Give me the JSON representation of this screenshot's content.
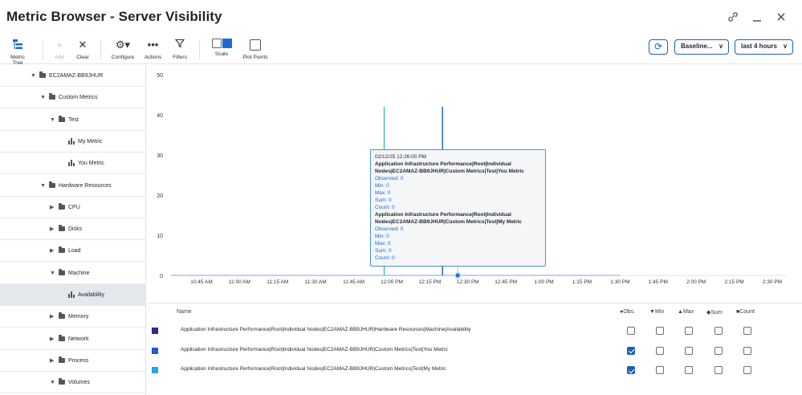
{
  "window": {
    "title": "Metric Browser - Server Visibility"
  },
  "toolbar": {
    "metric_tree": "Metric Tree",
    "add": "Add",
    "clear": "Clear",
    "configure": "Configure",
    "actions": "Actions",
    "filters": "Filters",
    "scale": "Scale",
    "plot_points": "Plot Points",
    "baseline": "Baseline...",
    "time_range": "last 4 hours"
  },
  "tree": [
    {
      "label": "EC2AMAZ-BB9JHUR",
      "type": "folder",
      "depth": 0,
      "expanded": true
    },
    {
      "label": "Custom Metrics",
      "type": "folder",
      "depth": 1,
      "expanded": true
    },
    {
      "label": "Test",
      "type": "folder",
      "depth": 2,
      "expanded": true
    },
    {
      "label": "My Metric",
      "type": "metric",
      "depth": 3
    },
    {
      "label": "You Metric",
      "type": "metric",
      "depth": 3
    },
    {
      "label": "Hardware Resources",
      "type": "folder",
      "depth": 1,
      "expanded": true
    },
    {
      "label": "CPU",
      "type": "folder",
      "depth": 2,
      "expanded": false
    },
    {
      "label": "Disks",
      "type": "folder",
      "depth": 2,
      "expanded": false
    },
    {
      "label": "Load",
      "type": "folder",
      "depth": 2,
      "expanded": false
    },
    {
      "label": "Machine",
      "type": "folder",
      "depth": 2,
      "expanded": true
    },
    {
      "label": "Availability",
      "type": "metric",
      "depth": 3,
      "selected": true
    },
    {
      "label": "Memory",
      "type": "folder",
      "depth": 2,
      "expanded": false
    },
    {
      "label": "Network",
      "type": "folder",
      "depth": 2,
      "expanded": false
    },
    {
      "label": "Process",
      "type": "folder",
      "depth": 2,
      "expanded": false
    },
    {
      "label": "Volumes",
      "type": "folder",
      "depth": 2,
      "expanded": true
    }
  ],
  "chart_data": {
    "type": "line",
    "y_ticks": [
      "50",
      "40",
      "30",
      "20",
      "10",
      "0"
    ],
    "ylim": [
      0,
      50
    ],
    "x_ticks": [
      "10:45 AM",
      "11:00 AM",
      "11:15 AM",
      "11:30 AM",
      "11:45 AM",
      "12:00 PM",
      "12:15 PM",
      "12:30 PM",
      "12:45 PM",
      "1:00 PM",
      "1:15 PM",
      "1:30 PM",
      "1:45 PM",
      "2:00 PM",
      "2:15 PM",
      "2:30 PM"
    ],
    "x_start_minutes": 645,
    "x_step_minutes": 15,
    "series": [
      {
        "name": "Application Infrastructure Performance|Root|Individual Nodes|EC2AMAZ-BB9JHUR|Custom Metrics|Test|You Metric",
        "color": "#1b6ad6",
        "spike_time": "12:20 PM",
        "spike_minutes": 740,
        "spike_value": 42,
        "baseline_value": 0,
        "baseline_end": "1:30 PM"
      },
      {
        "name": "Application Infrastructure Performance|Root|Individual Nodes|EC2AMAZ-BB9JHUR|Custom Metrics|Test|My Metric",
        "color": "#2aa6e8",
        "spike_time": "11:57 AM",
        "spike_minutes": 717,
        "spike_value": 42,
        "baseline_value": 0
      }
    ],
    "hover_time": "12:26 PM",
    "hover_minutes": 746
  },
  "tooltip": {
    "timestamp": "02/12/25 12:26:00 PM",
    "entries": [
      {
        "series": "Application Infrastructure Performance|Root|Individual Nodes|EC2AMAZ-BB9JHUR|Custom Metrics|Test|You Metric",
        "observed": "Observed: 0",
        "min": "Min: 0",
        "max": "Max: 0",
        "sum": "Sum: 0",
        "count": "Count: 0"
      },
      {
        "series": "Application Infrastructure Performance|Root|Individual Nodes|EC2AMAZ-BB9JHUR|Custom Metrics|Test|My Metric",
        "observed": "Observed: 0",
        "min": "Min: 0",
        "max": "Max: 0",
        "sum": "Sum: 0",
        "count": "Count: 0"
      }
    ]
  },
  "table": {
    "headers": {
      "name": "Name",
      "obs": "Obs.",
      "min": "Min",
      "max": "Max",
      "sum": "Sum",
      "count": "Count"
    },
    "rows": [
      {
        "name": "Application Infrastructure Performance|Root|Individual Nodes|EC2AMAZ-BB9JHUR|Hardware Resources|Machine|Availability",
        "color": "#2d2a8c",
        "obs": false,
        "min": false,
        "max": false,
        "sum": false,
        "count": false
      },
      {
        "name": "Application Infrastructure Performance|Root|Individual Nodes|EC2AMAZ-BB9JHUR|Custom Metrics|Test|You Metric",
        "color": "#1b5fd6",
        "obs": true,
        "min": false,
        "max": false,
        "sum": false,
        "count": false
      },
      {
        "name": "Application Infrastructure Performance|Root|Individual Nodes|EC2AMAZ-BB9JHUR|Custom Metrics|Test|My Metric",
        "color": "#2aa6e8",
        "obs": true,
        "min": false,
        "max": false,
        "sum": false,
        "count": false
      }
    ]
  }
}
